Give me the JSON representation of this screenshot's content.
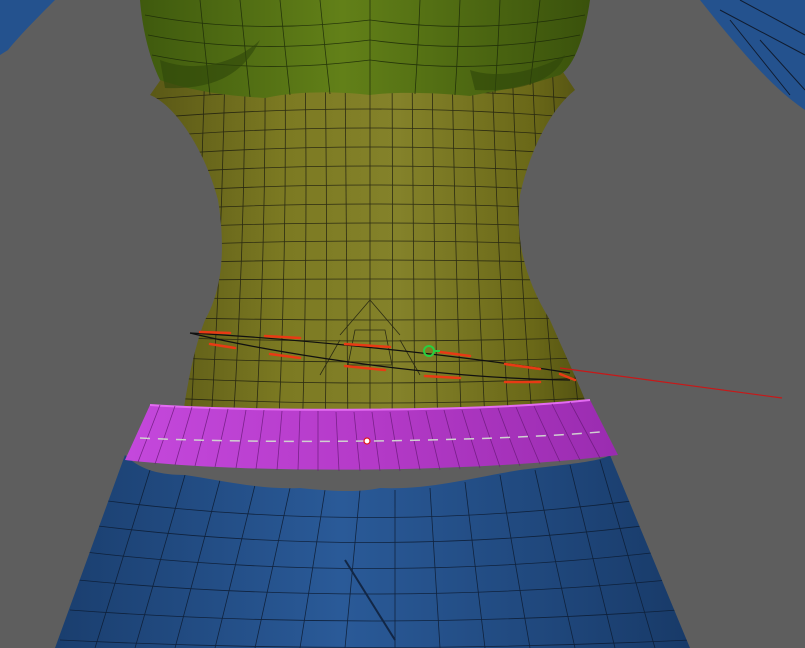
{
  "viewport": {
    "name": "3d-viewport",
    "background": "#5e5e5e"
  },
  "colors": {
    "torso": "#7c7a22",
    "chest": "#5d7a1a",
    "legs": "#24528e",
    "belt": "#b838cc",
    "wire": "#1e1e10",
    "selection": "#e83a14",
    "gizmo": "#26d040",
    "guide_line": "#c81818"
  }
}
